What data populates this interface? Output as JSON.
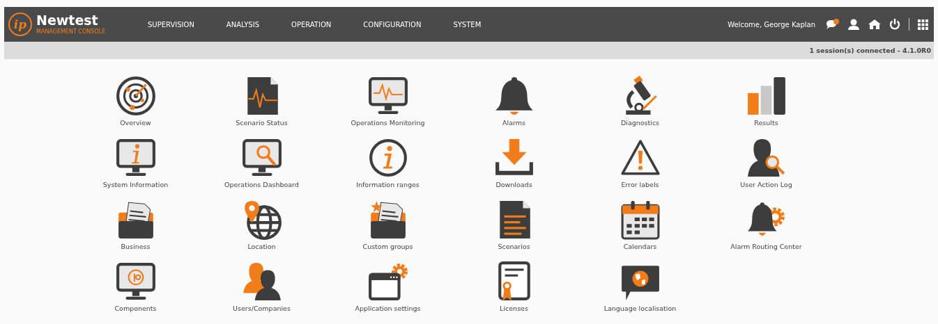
{
  "header": {
    "logo_mark": "ip",
    "brand": "Newtest",
    "subtitle": "MANAGEMENT CONSOLE",
    "nav": [
      "SUPERVISION",
      "ANALYSIS",
      "OPERATION",
      "CONFIGURATION",
      "SYSTEM"
    ],
    "welcome": "Welcome, George Kaplan",
    "notification": true
  },
  "status_bar": {
    "text": "1 session(s) connected - 4.1.0R0"
  },
  "tiles": [
    {
      "label": "Overview",
      "kind": "radar"
    },
    {
      "label": "Scenario Status",
      "kind": "doc-pulse"
    },
    {
      "label": "Operations Monitoring",
      "kind": "monitor-pulse"
    },
    {
      "label": "Alarms",
      "kind": "bell"
    },
    {
      "label": "Diagnostics",
      "kind": "microscope"
    },
    {
      "label": "Results",
      "kind": "bars"
    },
    {
      "label": "System Information",
      "kind": "monitor-info"
    },
    {
      "label": "Operations Dashboard",
      "kind": "monitor-search"
    },
    {
      "label": "Information ranges",
      "kind": "info-circle"
    },
    {
      "label": "Downloads",
      "kind": "download"
    },
    {
      "label": "Error labels",
      "kind": "warning"
    },
    {
      "label": "User Action Log",
      "kind": "user-search"
    },
    {
      "label": "Business",
      "kind": "folder-doc"
    },
    {
      "label": "Location",
      "kind": "globe-pin"
    },
    {
      "label": "Custom groups",
      "kind": "folder-star"
    },
    {
      "label": "Scenarios",
      "kind": "doc-lines"
    },
    {
      "label": "Calendars",
      "kind": "calendar"
    },
    {
      "label": "Alarm Routing Center",
      "kind": "bell-gear"
    },
    {
      "label": "Components",
      "kind": "monitor-logo"
    },
    {
      "label": "Users/Companies",
      "kind": "users"
    },
    {
      "label": "Application settings",
      "kind": "window-gear"
    },
    {
      "label": "Licenses",
      "kind": "certificate"
    },
    {
      "label": "Language localisation",
      "kind": "speech-globe"
    }
  ]
}
